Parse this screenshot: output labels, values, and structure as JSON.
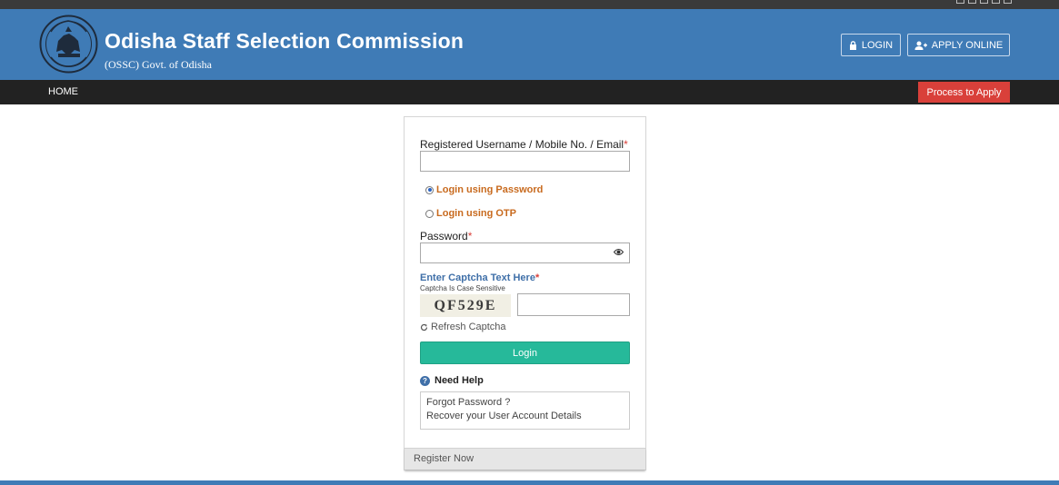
{
  "header": {
    "title": "Odisha Staff Selection Commission",
    "subtitle": "(OSSC) Govt. of Odisha",
    "login_label": "LOGIN",
    "apply_online_label": "APPLY ONLINE",
    "brand_color": "#3f7bb6"
  },
  "nav": {
    "home_label": "HOME",
    "process_label": "Process to Apply"
  },
  "form": {
    "username_label": "Registered Username / Mobile No. / Email",
    "required_mark": "*",
    "option_password": "Login using Password",
    "option_otp": "Login using OTP",
    "selected_option": "password",
    "password_label": "Password",
    "captcha_title": "Enter Captcha Text Here",
    "captcha_note": "Captcha Is Case Sensitive",
    "captcha_text": "QF529E",
    "refresh_label": "Refresh Captcha",
    "login_button": "Login",
    "need_help": "Need Help",
    "forgot_password": "Forgot Password ?",
    "recover_account": "Recover your User Account Details",
    "register_now": "Register Now"
  }
}
